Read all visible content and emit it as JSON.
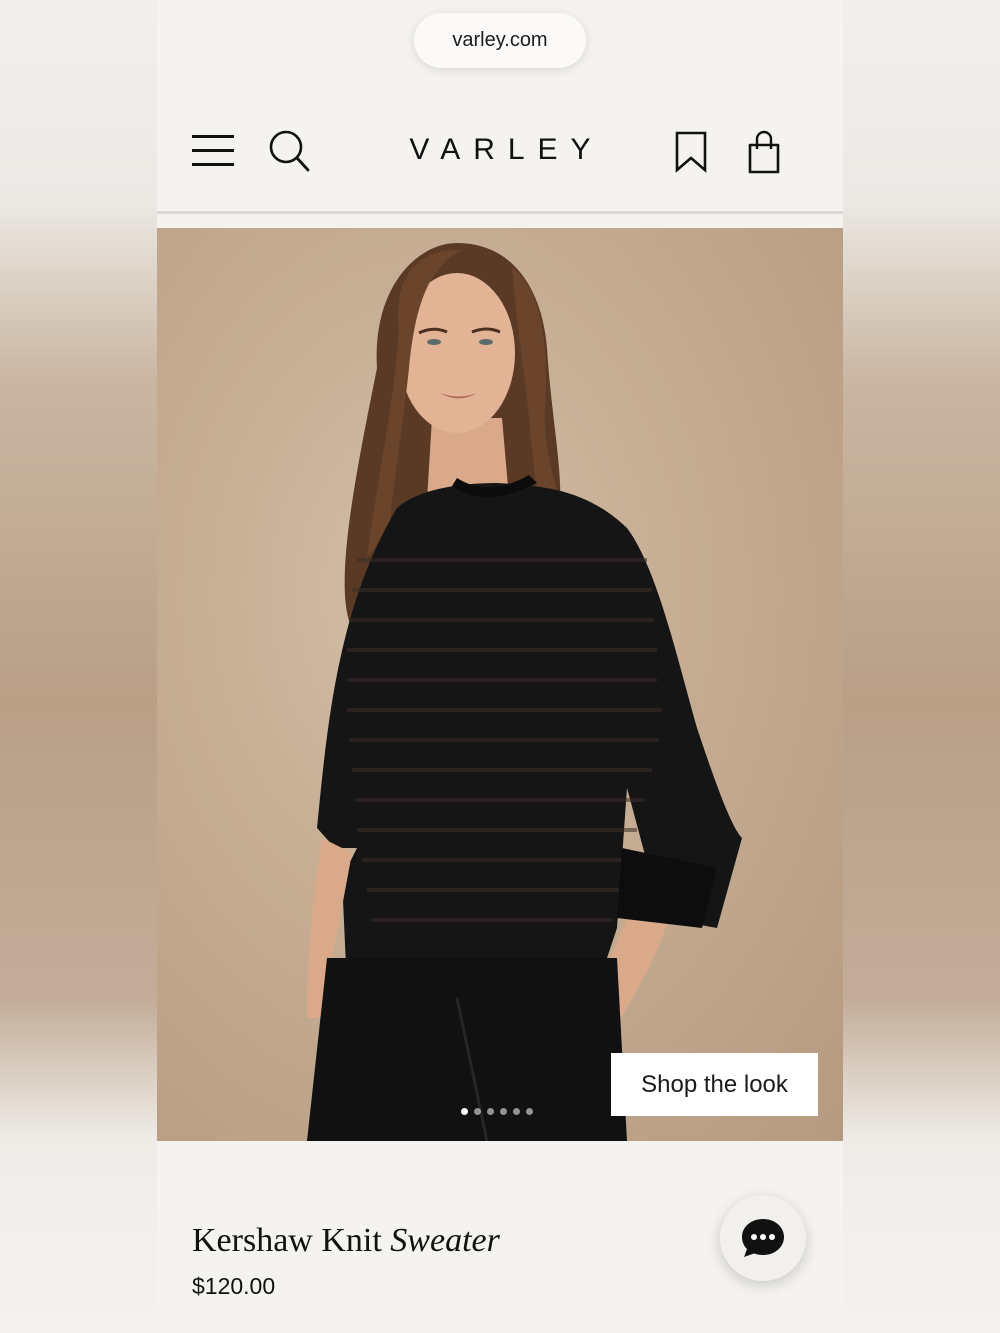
{
  "browser": {
    "url": "varley.com"
  },
  "header": {
    "logo": "VARLEY"
  },
  "hero": {
    "shop_the_look_label": "Shop the look",
    "carousel": {
      "total": 6,
      "active_index": 0
    }
  },
  "product": {
    "name_regular": "Kershaw Knit",
    "name_italic": "Sweater",
    "price": "$120.00"
  },
  "colors": {
    "page_bg": "#f5f3f0",
    "text": "#111111",
    "hero_bg": "#c5ac92"
  }
}
